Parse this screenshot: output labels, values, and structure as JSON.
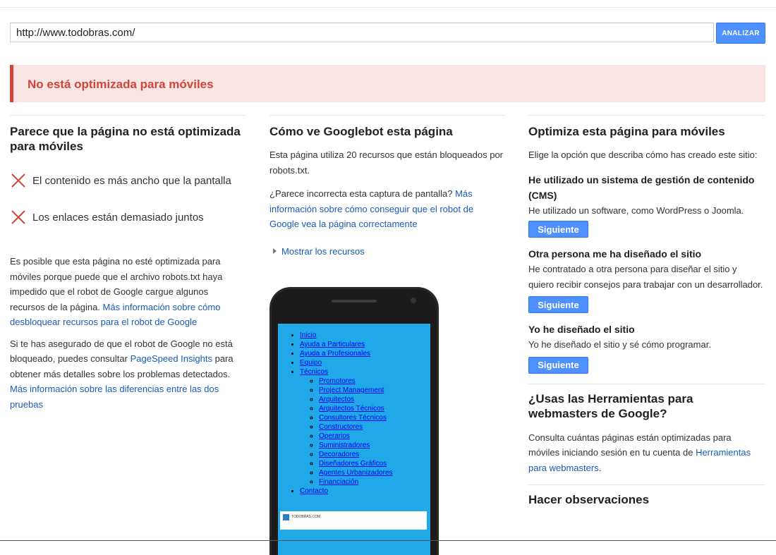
{
  "search": {
    "url_value": "http://www.todobras.com/",
    "analyze_label": "ANALIZAR"
  },
  "alert": {
    "text": "No está optimizada para móviles"
  },
  "col1": {
    "title": "Parece que la página no está optimizada para móviles",
    "issues": [
      "El contenido es más ancho que la pantalla",
      "Los enlaces están demasiado juntos"
    ],
    "p1_text": "Es posible que esta página no esté optimizada para móviles porque puede que el archivo robots.txt haya impedido que el robot de Google cargue algunos recursos de la página.",
    "p1_link": "Más información sobre cómo desbloquear recursos para el robot de Google",
    "p2_text": "Si te has asegurado de que el robot de Google no está bloqueado, puedes consultar",
    "p2_link": "PageSpeed Insights",
    "p2_text2": "para obtener más detalles sobre los problemas detectados.",
    "p2_link2": "Más información sobre las diferencias entre las dos pruebas"
  },
  "col2": {
    "title": "Cómo ve Googlebot esta página",
    "p1": "Esta página utiliza 20 recursos que están bloqueados por robots.txt.",
    "p2_text": "¿Parece incorrecta esta captura de pantalla?",
    "p2_link": "Más información sobre cómo conseguir que el robot de Google vea la página correctamente",
    "show_resources": "Mostrar los recursos",
    "phone_menu": {
      "top": [
        "Inicio",
        "Ayuda a Particulares",
        "Ayuda a Profesionales",
        "Equipo",
        "Técnicos"
      ],
      "sub": [
        "Promotores",
        "Project Management",
        "Arquitectos",
        "Arquitectos Técnicos",
        "Consultores Técnicos",
        "Constructores",
        "Operarios",
        "Suministradores",
        "Decoradores",
        "Diseñadores Gráficos",
        "Agentes Urbanizadores",
        "Financiación"
      ],
      "last": "Contacto"
    },
    "banner_text": "TODOBRAS.COM"
  },
  "col3": {
    "title": "Optimiza esta página para móviles",
    "intro": "Elige la opción que describa cómo has creado este sitio:",
    "opt1_title": "He utilizado un sistema de gestión de contenido (CMS)",
    "opt1_desc": "He utilizado un software, como WordPress o Joomla.",
    "opt2_title": "Otra persona me ha diseñado el sitio",
    "opt2_desc": "He contratado a otra persona para diseñar el sitio y quiero recibir consejos para trabajar con un desarrollador.",
    "opt3_title": "Yo he diseñado el sitio",
    "opt3_desc": "Yo he diseñado el sitio y sé cómo programar.",
    "next_label": "Siguiente",
    "wm_title": "¿Usas las Herramientas para webmasters de Google?",
    "wm_text": "Consulta cuántas páginas están optimizadas para móviles iniciando sesión en tu cuenta de",
    "wm_link": "Herramientas para webmasters",
    "wm_end": ".",
    "feedback_title": "Hacer observaciones"
  },
  "colors": {
    "accent": "#4d90fe",
    "error": "#d0453a",
    "link": "#1a5bb5",
    "alert_bg": "#f9e5e3"
  },
  "icons": {
    "issue": "x-icon",
    "expand": "triangle-right-icon"
  }
}
